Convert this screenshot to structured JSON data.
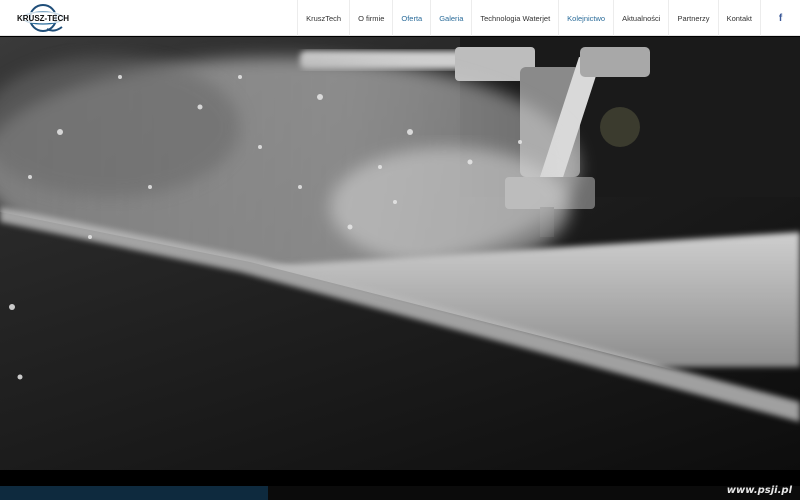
{
  "brand": {
    "logo_text": "KRUSZ-TECH",
    "logo_alt": "KruszTech"
  },
  "nav": {
    "items": [
      {
        "label": "KruszTech",
        "accent": false
      },
      {
        "label": "O firmie",
        "accent": false
      },
      {
        "label": "Oferta",
        "accent": true
      },
      {
        "label": "Galeria",
        "accent": true
      },
      {
        "label": "Technologia Waterjet",
        "accent": false
      },
      {
        "label": "Kolejnictwo",
        "accent": true
      },
      {
        "label": "Aktualności",
        "accent": false
      },
      {
        "label": "Partnerzy",
        "accent": false
      },
      {
        "label": "Kontakt",
        "accent": false
      }
    ],
    "social_icon": "facebook-icon",
    "social_glyph": "f"
  },
  "video": {
    "progress": 0.335
  },
  "watermark": "www.psji.pl",
  "colors": {
    "accent": "#2b6c9a",
    "facebook": "#3b5998",
    "progress": "#0e2a3e"
  }
}
